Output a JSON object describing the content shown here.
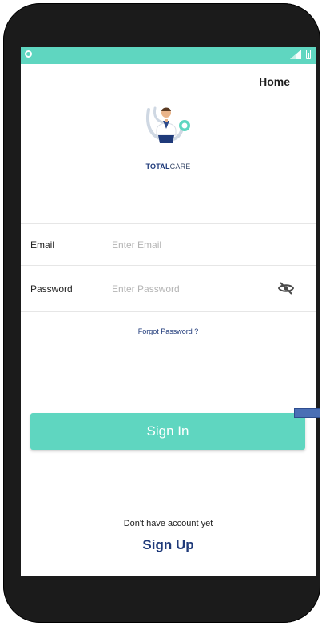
{
  "header": {
    "home_label": "Home"
  },
  "brand": {
    "part1": "TOTAL",
    "part2": "CARE"
  },
  "form": {
    "email_label": "Email",
    "email_placeholder": "Enter Email",
    "password_label": "Password",
    "password_placeholder": "Enter Password",
    "forgot_label": "Forgot Password ?",
    "signin_label": "Sign In"
  },
  "footer": {
    "no_account_text": "Don't have account yet",
    "signup_label": "Sign Up"
  },
  "colors": {
    "accent": "#5fd6c0",
    "brand_blue": "#1f3a7a"
  },
  "icons": {
    "status_left": "circle-icon",
    "signal": "signal-icon",
    "battery": "battery-icon",
    "password_toggle": "eye-off-icon",
    "logo": "doctor-stethoscope-logo"
  }
}
